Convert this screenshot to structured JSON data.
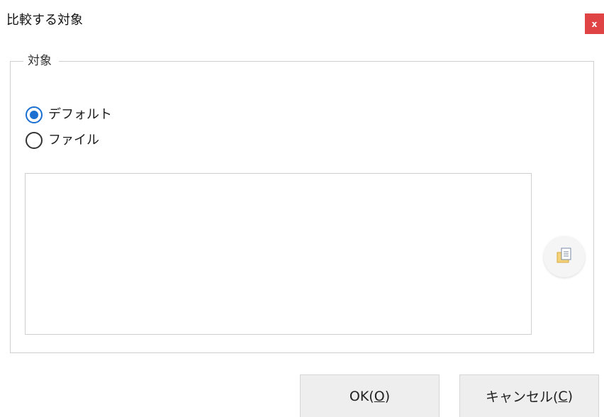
{
  "dialog": {
    "title": "比較する対象",
    "close_label": "x"
  },
  "group": {
    "label": "対象",
    "options": [
      {
        "label": "デフォルト",
        "selected": true
      },
      {
        "label": "ファイル",
        "selected": false
      }
    ]
  },
  "file_area": {
    "value": ""
  },
  "browse_button": {
    "icon": "document-browse-icon"
  },
  "buttons": {
    "ok": {
      "text": "OK(",
      "mnemonic": "O",
      "suffix": ")"
    },
    "cancel": {
      "text": "キャンセル(",
      "mnemonic": "C",
      "suffix": ")"
    }
  },
  "colors": {
    "accent": "#1a6fd1",
    "close": "#e04343"
  }
}
